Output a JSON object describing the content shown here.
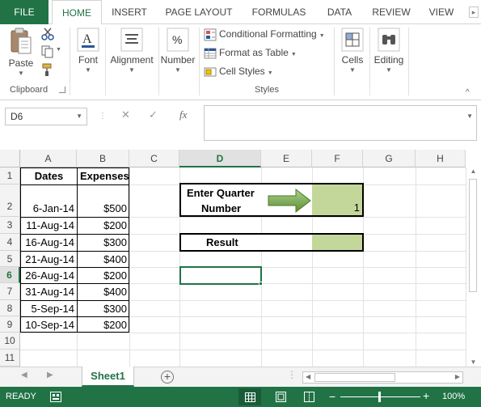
{
  "ribbon_tabs": {
    "file": "FILE",
    "home": "HOME",
    "insert": "INSERT",
    "page_layout": "PAGE LAYOUT",
    "formulas": "FORMULAS",
    "data": "DATA",
    "review": "REVIEW",
    "view": "VIEW"
  },
  "clipboard": {
    "paste": "Paste",
    "group_label": "Clipboard"
  },
  "font": {
    "label": "Font"
  },
  "alignment": {
    "label": "Alignment"
  },
  "number": {
    "label": "Number",
    "symbol": "%"
  },
  "styles": {
    "conditional_formatting": "Conditional Formatting",
    "format_as_table": "Format as Table",
    "cell_styles": "Cell Styles",
    "group_label": "Styles"
  },
  "cells": {
    "label": "Cells"
  },
  "editing": {
    "label": "Editing"
  },
  "formula_bar": {
    "name_box": "D6",
    "fx": "fx",
    "formula": ""
  },
  "columns": [
    "A",
    "B",
    "C",
    "D",
    "E",
    "F",
    "G",
    "H"
  ],
  "rows": [
    "1",
    "2",
    "3",
    "4",
    "5",
    "6",
    "7",
    "8",
    "9",
    "10",
    "11"
  ],
  "sheet": {
    "A1": "Dates",
    "B1": "Expenses",
    "data_rows": [
      {
        "date": "6-Jan-14",
        "expense": "$500"
      },
      {
        "date": "11-Aug-14",
        "expense": "$200"
      },
      {
        "date": "16-Aug-14",
        "expense": "$300"
      },
      {
        "date": "21-Aug-14",
        "expense": "$400"
      },
      {
        "date": "26-Aug-14",
        "expense": "$200"
      },
      {
        "date": "31-Aug-14",
        "expense": "$400"
      },
      {
        "date": "5-Sep-14",
        "expense": "$300"
      },
      {
        "date": "10-Sep-14",
        "expense": "$200"
      }
    ],
    "quarter_label_line1": "Enter Quarter",
    "quarter_label_line2": "Number",
    "quarter_value": "1",
    "result_label": "Result",
    "result_value": "",
    "input_fill": "#c4d79b"
  },
  "sheet_tabs": {
    "sheet1": "Sheet1",
    "add": "+"
  },
  "status_bar": {
    "ready": "READY",
    "zoom": "100%",
    "zoom_minus": "−",
    "zoom_plus": "+"
  },
  "colors": {
    "accent": "#217346",
    "arrow": "#77a94e"
  }
}
